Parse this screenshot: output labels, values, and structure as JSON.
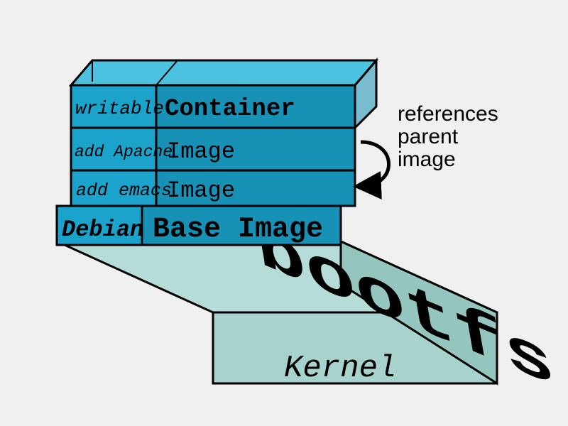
{
  "diagram_kind": "docker-image-layers",
  "layers": [
    {
      "left_label": "writable",
      "right_label": "Container"
    },
    {
      "left_label": "add Apache",
      "right_label": "Image"
    },
    {
      "left_label": "add emacs",
      "right_label": "Image"
    },
    {
      "left_label": "Debian",
      "right_label": "Base Image"
    }
  ],
  "base": {
    "top_label": "bootfs",
    "front_label": "Kernel"
  },
  "annotation": {
    "line1": "references",
    "line2": "parent",
    "line3": "image"
  },
  "colors": {
    "layer_left_fill": "#1ba3cc",
    "layer_right_fill": "#1791b6",
    "layer_top_fill": "#4ac2e0",
    "base_top_fill": "#b6dcd8",
    "base_front_fill": "#a7d2cd",
    "base_side_fill": "#95c5bf",
    "stroke": "#000000"
  }
}
